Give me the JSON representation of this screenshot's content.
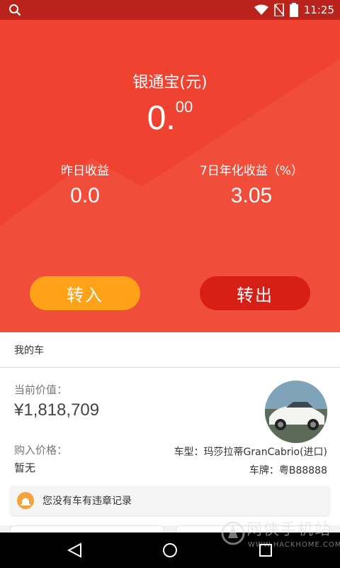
{
  "status_bar": {
    "time": "11:25"
  },
  "wallet": {
    "title": "银通宝(元)",
    "balance_int": "0.",
    "balance_dec": "00",
    "yesterday_label": "昨日收益",
    "yesterday_value": "0.0",
    "annual_label": "7日年化收益（%）",
    "annual_value": "3.05",
    "transfer_in_label": "转入",
    "transfer_out_label": "转出",
    "colors": {
      "hero": "#ef4230",
      "transfer_in": "#ffa217",
      "transfer_out": "#d71f18"
    }
  },
  "my_car": {
    "header": "我的车",
    "current_value_label": "当前价值：",
    "current_value": "¥1,818,709",
    "purchase_price_label": "购入价格：",
    "purchase_price": "暂无",
    "model": "车型：玛莎拉蒂GranCabrio(进口)",
    "plate": "车牌：粤B88888",
    "notice_text": "您没有车有违章记录",
    "notice_icon": "siren-icon"
  },
  "watermark": {
    "brand": "网侠手机站",
    "url": "WWW.HACKHOME.COM"
  },
  "icons": [
    "search-icon",
    "wifi-icon",
    "no-sim-icon",
    "battery-icon",
    "back-icon",
    "home-icon",
    "recents-icon"
  ]
}
